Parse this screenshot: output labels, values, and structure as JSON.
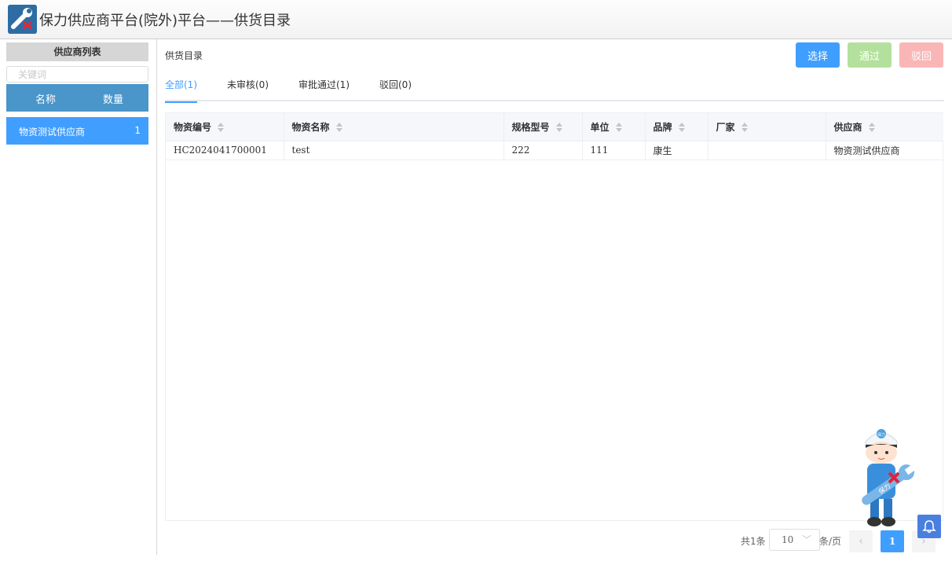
{
  "header": {
    "title": "保力供应商平台(院外)平台——供货目录",
    "logo_icon": "wrench-logo-icon"
  },
  "sidebar": {
    "heading": "供应商列表",
    "search_placeholder": "关键词",
    "columns": {
      "name": "名称",
      "count": "数量"
    },
    "items": [
      {
        "name": "物资测试供应商",
        "count": "1"
      }
    ]
  },
  "main": {
    "title": "供货目录",
    "buttons": {
      "select": "选择",
      "approve": "通过",
      "reject": "驳回"
    },
    "tabs": [
      {
        "label": "全部(1)",
        "active": true
      },
      {
        "label": "未审核(0)",
        "active": false
      },
      {
        "label": "审批通过(1)",
        "active": false
      },
      {
        "label": "驳回(0)",
        "active": false
      }
    ],
    "table": {
      "columns": [
        "物资编号",
        "物资名称",
        "规格型号",
        "单位",
        "品牌",
        "厂家",
        "供应商"
      ],
      "rows": [
        [
          "HC2024041700001",
          "test",
          "222",
          "111",
          "康生",
          "",
          "物资测试供应商"
        ]
      ]
    },
    "pagination": {
      "total": "共1条",
      "page_size": "10",
      "page_size_unit": "条/页",
      "current_page": "1",
      "prev_icon": "chevron-left-icon",
      "next_icon": "chevron-right-icon"
    }
  },
  "colors": {
    "primary": "#409eff",
    "success_disabled": "#b3e19d",
    "danger_disabled": "#fab6b6",
    "sidebar_header": "#4a95c9"
  },
  "mascot": {
    "badge": "保力",
    "wrench_text": "保力"
  }
}
